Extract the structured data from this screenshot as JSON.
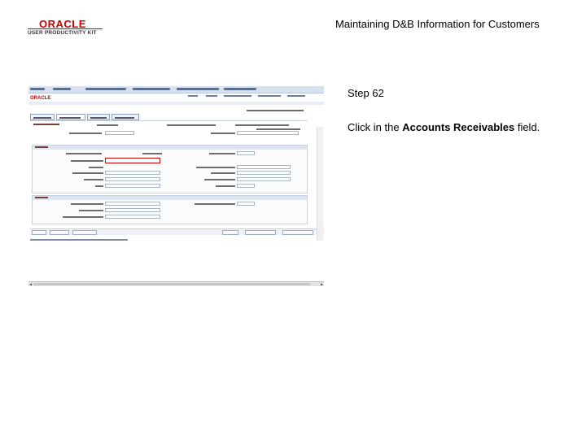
{
  "logo": {
    "brand": "ORACLE",
    "subtitle": "USER PRODUCTIVITY KIT"
  },
  "header": {
    "title": "Maintaining D&B Information for Customers"
  },
  "step": {
    "label": "Step 62",
    "instruction_prefix": "Click in the ",
    "instruction_target": "Accounts Receivables",
    "instruction_suffix": " field."
  },
  "screenshot": {
    "highlighted_field": "Accounts Receivables",
    "colors": {
      "highlight": "#cc0000",
      "nav": "#d7e1ef"
    }
  }
}
